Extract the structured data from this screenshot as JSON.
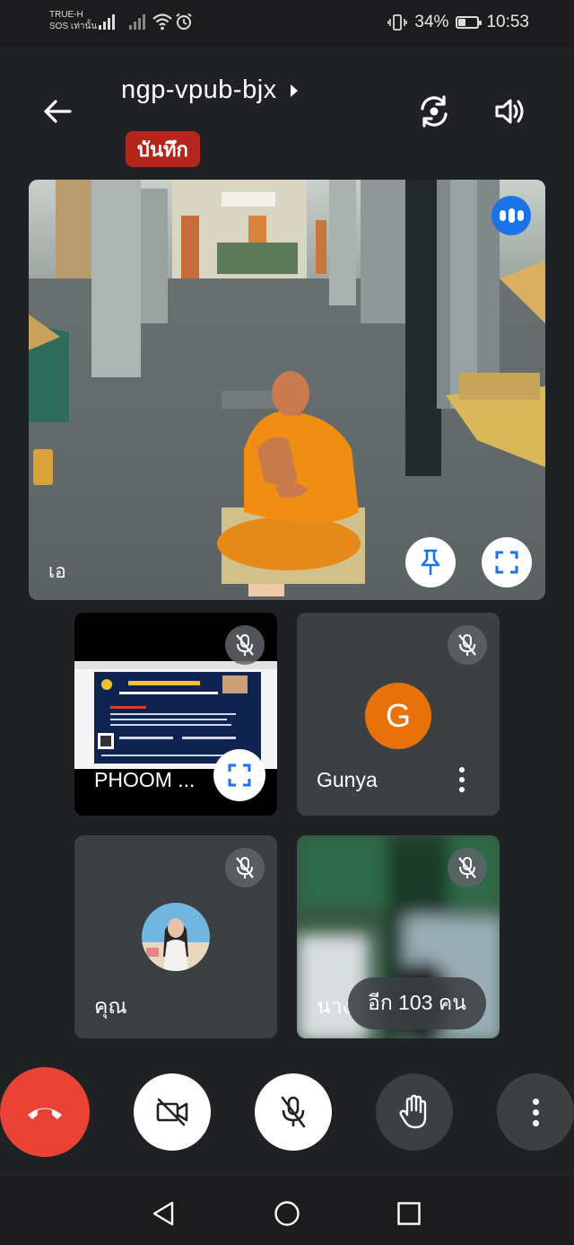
{
  "status_bar": {
    "carrier_line1": "TRUE-H",
    "carrier_line2": "SOS เท่านั้น",
    "battery": "34%",
    "battery_level": 0.34,
    "time": "10:53"
  },
  "header": {
    "meeting_code": "ngp-vpub-bjx",
    "recording_label": "บันทึก"
  },
  "main_video": {
    "participant_name": "เอ"
  },
  "participants": [
    {
      "name": "PHOOM  ...",
      "avatar_letter": "",
      "avatar_color": ""
    },
    {
      "name": "Gunya",
      "avatar_letter": "G",
      "avatar_color": "#e8710a"
    },
    {
      "name": "คุณ",
      "avatar_letter": "",
      "avatar_color": ""
    },
    {
      "name": "นาง",
      "avatar_letter": "",
      "avatar_color": ""
    }
  ],
  "more_participants_label": "อีก 103 คน",
  "colors": {
    "background": "#202124",
    "tile": "#3c4043",
    "end_call": "#ea4335",
    "record": "#b3261e"
  }
}
